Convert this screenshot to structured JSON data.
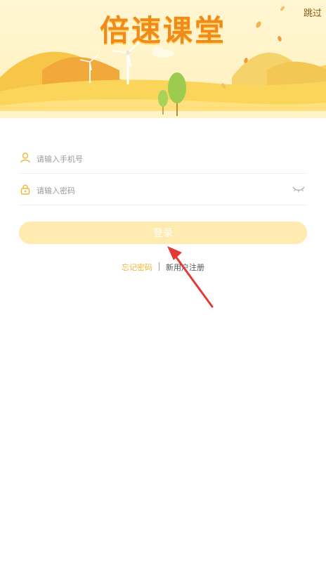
{
  "header": {
    "title": "倍速课堂",
    "skip_label": "跳过"
  },
  "login_form": {
    "phone_placeholder": "请输入手机号",
    "password_placeholder": "请输入密码",
    "login_label": "登录"
  },
  "links": {
    "forgot_password": "忘记密码",
    "register": "新用户注册"
  },
  "colors": {
    "accent": "#f2b634",
    "title": "#f08a1a",
    "button_bg": "#ffeab0",
    "annotation_arrow": "#e53935"
  },
  "icons": [
    "user-icon",
    "lock-icon",
    "eye-closed-icon"
  ]
}
